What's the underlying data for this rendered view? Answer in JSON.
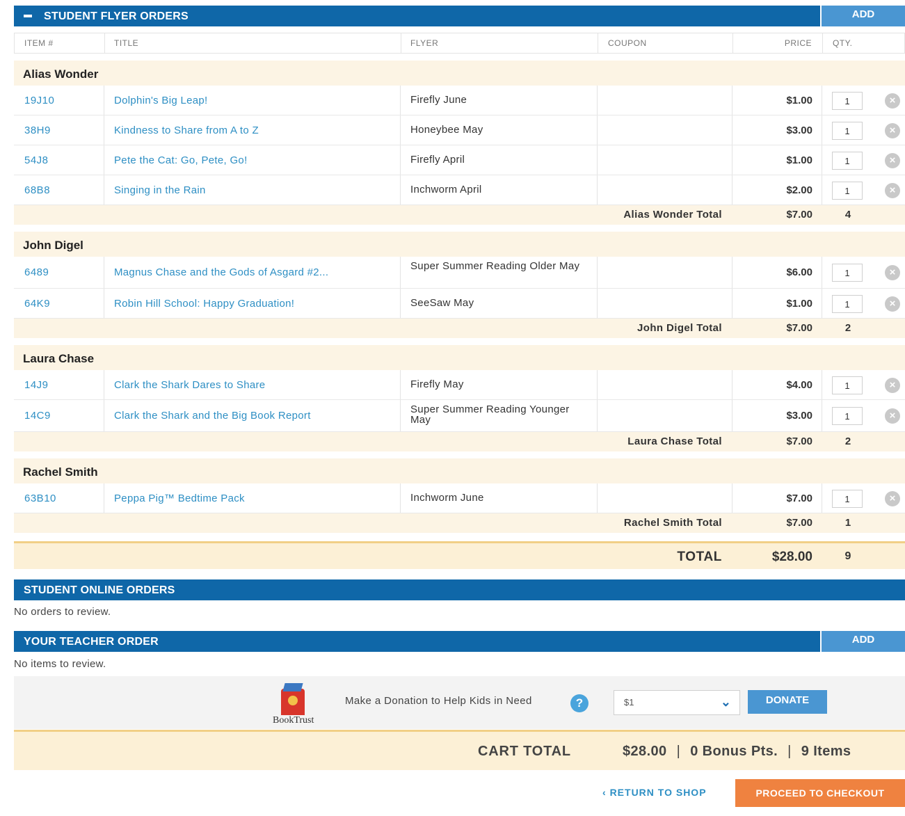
{
  "flyer_section": {
    "title": "STUDENT FLYER ORDERS",
    "add_label": "ADD",
    "headers": {
      "item": "ITEM #",
      "title": "TITLE",
      "flyer": "FLYER",
      "coupon": "COUPON",
      "price": "PRICE",
      "qty": "QTY."
    },
    "students": [
      {
        "name": "Alias Wonder",
        "items": [
          {
            "item": "19J10",
            "title": "Dolphin's Big Leap!",
            "flyer": "Firefly June",
            "price": "$1.00",
            "qty": "1"
          },
          {
            "item": "38H9",
            "title": "Kindness to Share from A to Z",
            "flyer": "Honeybee May",
            "price": "$3.00",
            "qty": "1"
          },
          {
            "item": "54J8",
            "title": "Pete the Cat: Go, Pete, Go!",
            "flyer": "Firefly April",
            "price": "$1.00",
            "qty": "1"
          },
          {
            "item": "68B8",
            "title": "Singing in the Rain",
            "flyer": "Inchworm April",
            "price": "$2.00",
            "qty": "1"
          }
        ],
        "total_label": "Alias Wonder Total",
        "total": "$7.00",
        "total_qty": "4"
      },
      {
        "name": "John Digel",
        "items": [
          {
            "item": "6489",
            "title": "Magnus Chase and the Gods of Asgard #2...",
            "flyer": "Super Summer Reading Older May",
            "price": "$6.00",
            "qty": "1"
          },
          {
            "item": "64K9",
            "title": "Robin Hill School: Happy Graduation!",
            "flyer": "SeeSaw May",
            "price": "$1.00",
            "qty": "1"
          }
        ],
        "total_label": "John Digel Total",
        "total": "$7.00",
        "total_qty": "2"
      },
      {
        "name": "Laura Chase",
        "items": [
          {
            "item": "14J9",
            "title": "Clark the Shark Dares to Share",
            "flyer": "Firefly May",
            "price": "$4.00",
            "qty": "1"
          },
          {
            "item": "14C9",
            "title": "Clark the Shark and the Big Book Report",
            "flyer": "Super Summer Reading Younger May",
            "price": "$3.00",
            "qty": "1"
          }
        ],
        "total_label": "Laura Chase Total",
        "total": "$7.00",
        "total_qty": "2"
      },
      {
        "name": "Rachel Smith",
        "items": [
          {
            "item": "63B10",
            "title": "Peppa Pig™ Bedtime Pack",
            "flyer": "Inchworm June",
            "price": "$7.00",
            "qty": "1"
          }
        ],
        "total_label": "Rachel Smith Total",
        "total": "$7.00",
        "total_qty": "1"
      }
    ],
    "grand_total_label": "TOTAL",
    "grand_total": "$28.00",
    "grand_total_qty": "9"
  },
  "online_section": {
    "title": "STUDENT ONLINE ORDERS",
    "empty_text": "No orders to review."
  },
  "teacher_section": {
    "title": "YOUR TEACHER ORDER",
    "add_label": "ADD",
    "empty_text": "No items to review."
  },
  "donation": {
    "logo_text": "BookTrust",
    "text": "Make a Donation to Help Kids in Need",
    "help_icon": "question-icon",
    "selected": "$1",
    "button": "DONATE"
  },
  "cart": {
    "label": "CART TOTAL",
    "amount": "$28.00",
    "bonus": "0 Bonus Pts.",
    "items": "9 Items",
    "separator": "|"
  },
  "actions": {
    "return": "RETURN TO SHOP",
    "checkout": "PROCEED TO CHECKOUT"
  },
  "colors": {
    "header_bar": "#0f67a8",
    "add_button": "#4a96d2",
    "link": "#2e8fc4",
    "subtotal_bg": "#fcf4e4",
    "checkout": "#ef8240"
  }
}
